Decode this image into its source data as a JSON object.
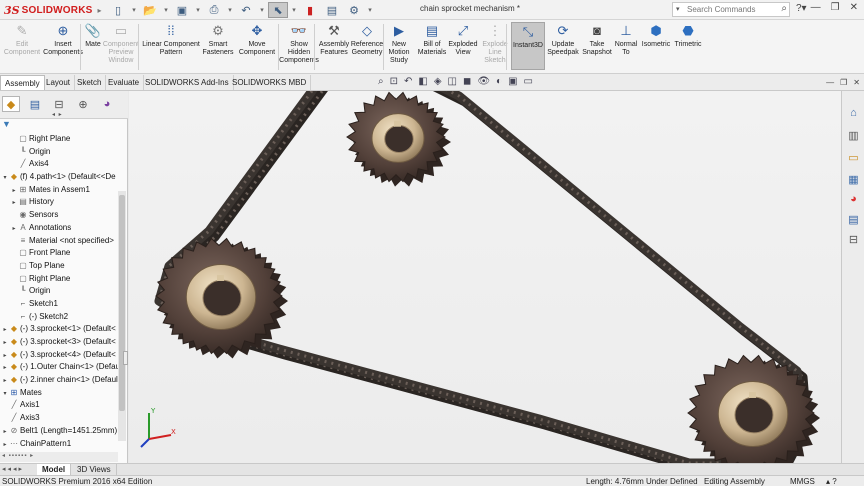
{
  "app": {
    "logo_prefix": "3S",
    "logo_text": "SOLIDWORKS",
    "doc_title": "chain sprocket mechanism *",
    "search_placeholder": "Search Commands",
    "brand_red": "#d11d1d"
  },
  "commands": [
    {
      "id": "edit-component",
      "label": "Edit\nComponent",
      "icon": "edit-component-icon",
      "disabled": true
    },
    {
      "id": "insert-components",
      "label": "Insert\nComponents",
      "icon": "insert-components-icon",
      "disabled": false
    },
    {
      "id": "mate",
      "label": "Mate",
      "icon": "mate-icon",
      "disabled": false
    },
    {
      "id": "component-preview",
      "label": "Component\nPreview\nWindow",
      "icon": "preview-window-icon",
      "disabled": true
    },
    {
      "id": "linear-pattern",
      "label": "Linear Component\nPattern",
      "icon": "linear-pattern-icon",
      "disabled": false
    },
    {
      "id": "smart-fasteners",
      "label": "Smart\nFasteners",
      "icon": "smart-fasteners-icon",
      "disabled": false
    },
    {
      "id": "move-component",
      "label": "Move\nComponent",
      "icon": "move-component-icon",
      "disabled": false
    },
    {
      "id": "show-hidden",
      "label": "Show\nHidden\nComponents",
      "icon": "show-hidden-icon",
      "disabled": false
    },
    {
      "id": "assembly-features",
      "label": "Assembly\nFeatures",
      "icon": "assembly-features-icon",
      "disabled": false
    },
    {
      "id": "reference-geometry",
      "label": "Reference\nGeometry",
      "icon": "reference-geometry-icon",
      "disabled": false
    },
    {
      "id": "new-motion-study",
      "label": "New\nMotion\nStudy",
      "icon": "motion-study-icon",
      "disabled": false
    },
    {
      "id": "bill-of-materials",
      "label": "Bill of\nMaterials",
      "icon": "bom-icon",
      "disabled": false
    },
    {
      "id": "exploded-view",
      "label": "Exploded\nView",
      "icon": "exploded-view-icon",
      "disabled": false
    },
    {
      "id": "explode-line-sketch",
      "label": "Explode\nLine\nSketch",
      "icon": "explode-line-icon",
      "disabled": true
    },
    {
      "id": "instant3d",
      "label": "Instant3D",
      "icon": "instant3d-icon",
      "disabled": false,
      "active": true
    },
    {
      "id": "update-speedpak",
      "label": "Update\nSpeedpak",
      "icon": "speedpak-icon",
      "disabled": false
    },
    {
      "id": "take-snapshot",
      "label": "Take\nSnapshot",
      "icon": "camera-icon",
      "disabled": false
    },
    {
      "id": "normal-to",
      "label": "Normal\nTo",
      "icon": "normal-to-icon",
      "disabled": false
    },
    {
      "id": "isometric",
      "label": "Isometric",
      "icon": "isometric-icon",
      "disabled": false
    },
    {
      "id": "trimetric",
      "label": "Trimetric",
      "icon": "trimetric-icon",
      "disabled": false
    }
  ],
  "tabs": [
    "Assembly",
    "Layout",
    "Sketch",
    "Evaluate",
    "SOLIDWORKS Add-Ins",
    "SOLIDWORKS MBD"
  ],
  "active_tab": "Assembly",
  "tree": [
    {
      "indent": 1,
      "exp": "",
      "icon": "plane-icon",
      "cls": "gray",
      "glyph": "▢",
      "label": "Right Plane"
    },
    {
      "indent": 1,
      "exp": "",
      "icon": "origin-icon",
      "cls": "gray",
      "glyph": "┖",
      "label": "Origin"
    },
    {
      "indent": 1,
      "exp": "",
      "icon": "axis-icon",
      "cls": "gray",
      "glyph": "╱",
      "label": "Axis4"
    },
    {
      "indent": 0,
      "exp": "▾",
      "icon": "part-icon",
      "cls": "gold",
      "glyph": "◆",
      "label": "(f) 4.path<1> (Default<<De"
    },
    {
      "indent": 1,
      "exp": "▸",
      "icon": "mates-icon",
      "cls": "gray",
      "glyph": "⊞",
      "label": "Mates in Assem1"
    },
    {
      "indent": 1,
      "exp": "▸",
      "icon": "history-icon",
      "cls": "gray",
      "glyph": "▤",
      "label": "History"
    },
    {
      "indent": 1,
      "exp": "",
      "icon": "sensors-icon",
      "cls": "gray",
      "glyph": "◉",
      "label": "Sensors"
    },
    {
      "indent": 1,
      "exp": "▸",
      "icon": "annotations-icon",
      "cls": "gray",
      "glyph": "A",
      "label": "Annotations"
    },
    {
      "indent": 1,
      "exp": "",
      "icon": "material-icon",
      "cls": "gray",
      "glyph": "≡",
      "label": "Material <not specified>"
    },
    {
      "indent": 1,
      "exp": "",
      "icon": "plane-icon",
      "cls": "gray",
      "glyph": "▢",
      "label": "Front Plane"
    },
    {
      "indent": 1,
      "exp": "",
      "icon": "plane-icon",
      "cls": "gray",
      "glyph": "▢",
      "label": "Top Plane"
    },
    {
      "indent": 1,
      "exp": "",
      "icon": "plane-icon",
      "cls": "gray",
      "glyph": "▢",
      "label": "Right Plane"
    },
    {
      "indent": 1,
      "exp": "",
      "icon": "origin-icon",
      "cls": "gray",
      "glyph": "┖",
      "label": "Origin"
    },
    {
      "indent": 1,
      "exp": "",
      "icon": "sketch-icon",
      "cls": "gray",
      "glyph": "⌐",
      "label": "Sketch1"
    },
    {
      "indent": 1,
      "exp": "",
      "icon": "sketch-icon",
      "cls": "gray",
      "glyph": "⌐",
      "label": "(-) Sketch2"
    },
    {
      "indent": 0,
      "exp": "▸",
      "icon": "part-icon",
      "cls": "gold",
      "glyph": "◆",
      "label": "(-) 3.sprocket<1> (Default<"
    },
    {
      "indent": 0,
      "exp": "▸",
      "icon": "part-icon",
      "cls": "gold",
      "glyph": "◆",
      "label": "(-) 3.sprocket<3> (Default<"
    },
    {
      "indent": 0,
      "exp": "▸",
      "icon": "part-icon",
      "cls": "gold",
      "glyph": "◆",
      "label": "(-) 3.sprocket<4> (Default<"
    },
    {
      "indent": 0,
      "exp": "▸",
      "icon": "part-icon",
      "cls": "gold",
      "glyph": "◆",
      "label": "(-) 1.Outer Chain<1> (Defau"
    },
    {
      "indent": 0,
      "exp": "▸",
      "icon": "part-icon",
      "cls": "gold",
      "glyph": "◆",
      "label": "(-) 2.inner chain<1> (Defaul"
    },
    {
      "indent": 0,
      "exp": "▾",
      "icon": "mates-icon",
      "cls": "blue",
      "glyph": "⊞",
      "label": "Mates"
    },
    {
      "indent": 0,
      "exp": "",
      "icon": "axis-icon",
      "cls": "gray",
      "glyph": "╱",
      "label": "Axis1"
    },
    {
      "indent": 0,
      "exp": "",
      "icon": "axis-icon",
      "cls": "gray",
      "glyph": "╱",
      "label": "Axis3"
    },
    {
      "indent": 0,
      "exp": "▸",
      "icon": "belt-icon",
      "cls": "gray",
      "glyph": "⊘",
      "label": "Belt1 (Length=1451.25mm)"
    },
    {
      "indent": 0,
      "exp": "▸",
      "icon": "pattern-icon",
      "cls": "gray",
      "glyph": "⋯",
      "label": "ChainPattern1"
    }
  ],
  "bottom_tabs": [
    "Model",
    "3D Views"
  ],
  "active_bottom_tab": "Model",
  "status": {
    "edition": "SOLIDWORKS Premium 2016 x64 Edition",
    "length": "Length: 4.76mm",
    "definition": "Under Defined",
    "mode": "Editing Assembly",
    "units": "MMGS"
  },
  "colors": {
    "sprocket": "#5a4a44",
    "chain": "#3a3430",
    "bore": "#d9c6a2"
  }
}
